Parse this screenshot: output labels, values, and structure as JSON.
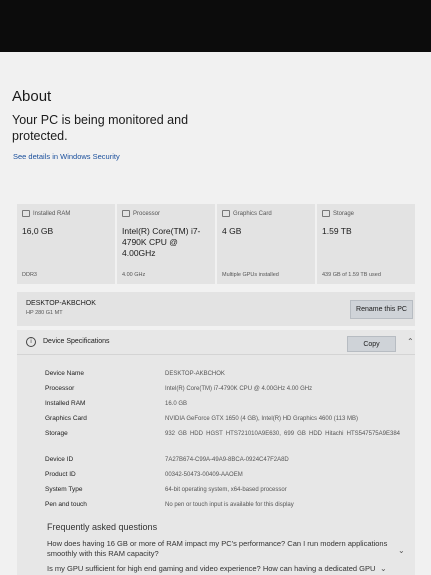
{
  "header": {
    "title": "About",
    "protection": "Your PC is being monitored and protected.",
    "security_link": "See details in Windows Security"
  },
  "cards": [
    {
      "label": "Installed RAM",
      "icon": "ram-icon",
      "value": "16,0 GB",
      "sub": "DDR3"
    },
    {
      "label": "Processor",
      "icon": "processor-icon",
      "value": "Intel(R) Core(TM) i7-4790K CPU @ 4.00GHz",
      "sub": "4.00 GHz"
    },
    {
      "label": "Graphics Card",
      "icon": "graphics-card-icon",
      "value": "4 GB",
      "sub": "Multiple GPUs installed"
    },
    {
      "label": "Storage",
      "icon": "storage-icon",
      "value": "1.59 TB",
      "sub": "439 GB of 1.59 TB used"
    }
  ],
  "device": {
    "name": "DESKTOP-AKBCHOK",
    "model": "HP 280 G1 MT",
    "rename_label": "Rename this PC"
  },
  "specs": {
    "title": "Device Specifications",
    "copy_label": "Copy",
    "rows": [
      {
        "key": "Device Name",
        "value": "DESKTOP-AKBCHOK"
      },
      {
        "key": "Processor",
        "value": "Intel(R) Core(TM) i7-4790K CPU @ 4.00GHz   4.00 GHz"
      },
      {
        "key": "Installed RAM",
        "value": "16.0 GB"
      },
      {
        "key": "Graphics Card",
        "value": "NVIDIA GeForce GTX 1650 (4 GB), Intel(R) HD Graphics 4600 (113 MB)"
      },
      {
        "key": "Storage",
        "value": "932 GB HDD HGST HTS721010A9E630, 699 GB HDD Hitachi HTS547575A9E384"
      },
      {
        "key": "Device ID",
        "value": "7A27B674-C99A-49A9-8BCA-0924C47F2A8D"
      },
      {
        "key": "Product ID",
        "value": "00342-50473-00409-AAOEM"
      },
      {
        "key": "System Type",
        "value": "64-bit operating system, x64-based processor"
      },
      {
        "key": "Pen and touch",
        "value": "No pen or touch input is available for this display"
      }
    ]
  },
  "faq": {
    "title": "Frequently asked questions",
    "q1": "How does having 16 GB or more of RAM impact my PC's performance? Can I run modern applications smoothly with this RAM capacity?",
    "q2": "Is my GPU sufficient for high end gaming and video experience? How can having a dedicated GPU"
  }
}
